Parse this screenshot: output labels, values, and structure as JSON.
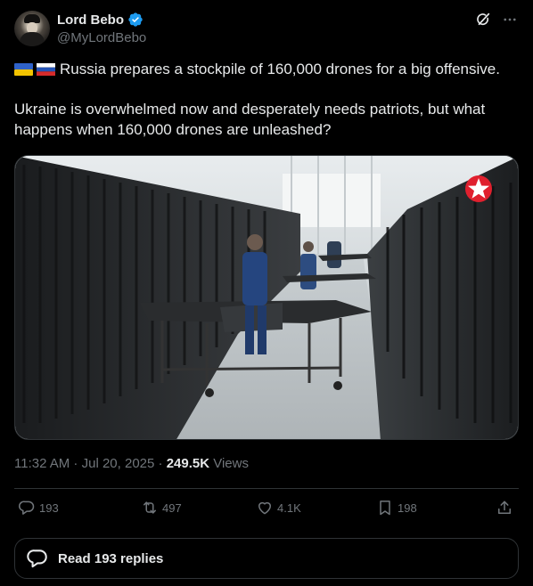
{
  "author": {
    "name": "Lord Bebo",
    "handle": "@MyLordBebo"
  },
  "post": {
    "line1": "Russia prepares a stockpile of 160,000 drones for a big offensive.",
    "line2": "Ukraine is overwhelmed now and desperately needs patriots, but what happens when 160,000 drones are unleashed?",
    "flags": [
      "ukraine-flag",
      "russia-flag"
    ]
  },
  "meta": {
    "time": "11:32 AM",
    "separator1": " · ",
    "date": "Jul 20, 2025",
    "separator2": " · ",
    "views_count": "249.5K",
    "views_label": " Views"
  },
  "actions": {
    "replies": "193",
    "reposts": "497",
    "likes": "4.1K",
    "bookmarks": "198"
  },
  "read_replies_label": "Read 193 replies",
  "colors": {
    "background": "#000000",
    "text_primary": "#e7e9ea",
    "text_secondary": "#71767b",
    "border": "#2f3336",
    "verified": "#1d9bf0",
    "star_logo": "#e0202e"
  }
}
